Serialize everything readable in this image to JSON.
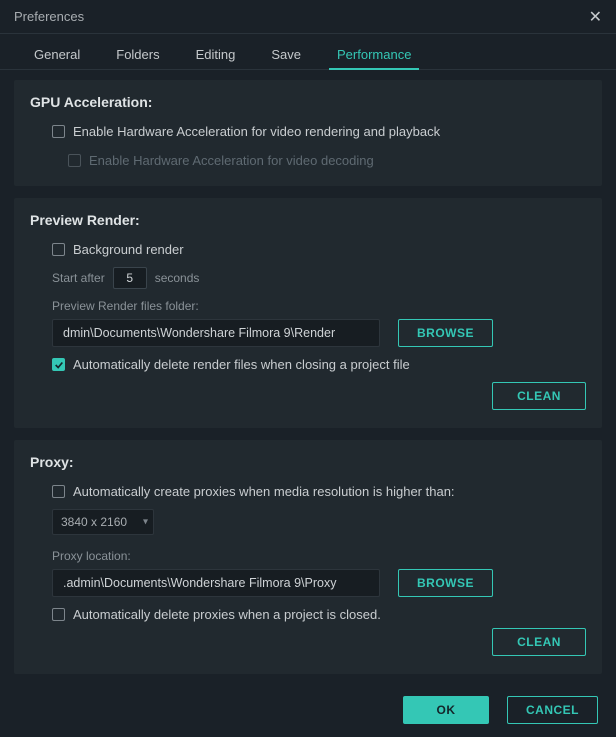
{
  "window": {
    "title": "Preferences"
  },
  "tabs": {
    "general": "General",
    "folders": "Folders",
    "editing": "Editing",
    "save": "Save",
    "performance": "Performance"
  },
  "gpu": {
    "heading": "GPU Acceleration:",
    "enable_rendering": "Enable Hardware Acceleration for video rendering and playback",
    "enable_decoding": "Enable Hardware Acceleration for video decoding"
  },
  "preview": {
    "heading": "Preview Render:",
    "background_render": "Background render",
    "start_after_pre": "Start after",
    "start_after_value": "5",
    "start_after_post": "seconds",
    "folder_label": "Preview Render files folder:",
    "folder_value": "dmin\\Documents\\Wondershare Filmora 9\\Render",
    "browse": "BROWSE",
    "auto_delete": "Automatically delete render files when closing a project file",
    "clean": "CLEAN"
  },
  "proxy": {
    "heading": "Proxy:",
    "auto_create": "Automatically create proxies when media resolution is higher than:",
    "resolution": "3840 x 2160",
    "location_label": "Proxy location:",
    "location_value": ".admin\\Documents\\Wondershare Filmora 9\\Proxy",
    "browse": "BROWSE",
    "auto_delete": "Automatically delete proxies when a project is closed.",
    "clean": "CLEAN"
  },
  "footer": {
    "ok": "OK",
    "cancel": "CANCEL"
  }
}
